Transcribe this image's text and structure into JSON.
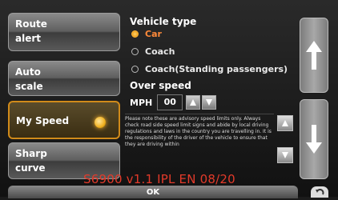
{
  "sidebar": {
    "items": [
      {
        "line1": "Route",
        "line2": "alert"
      },
      {
        "line1": "Auto",
        "line2": "scale"
      },
      {
        "line1": "My Speed",
        "line2": ""
      },
      {
        "line1": "Sharp",
        "line2": "curve"
      }
    ]
  },
  "vehicle": {
    "title": "Vehicle type",
    "options": [
      "Car",
      "Coach",
      "Coach(Standing passengers)"
    ],
    "selected": "Car"
  },
  "overspeed": {
    "title": "Over speed",
    "unit": "MPH",
    "value": "00"
  },
  "note": {
    "text": "Please note these are advisory speed limits only. Always check road side speed limit signs and abide by local driving regulations and laws in the country you are travelling in. It is the responsibility of the driver of the vehicle to ensure that they are driving within"
  },
  "bottom": {
    "ok_label": "OK"
  },
  "watermark": {
    "text": "S6900 v1.1 IPL EN 08/20"
  },
  "icons": {
    "up": "arrow-up-icon",
    "down": "arrow-down-icon",
    "back": "back-icon"
  },
  "colors": {
    "accent": "#d08a1a",
    "selected_text": "#ff8a3a",
    "watermark": "#e23a2a"
  }
}
